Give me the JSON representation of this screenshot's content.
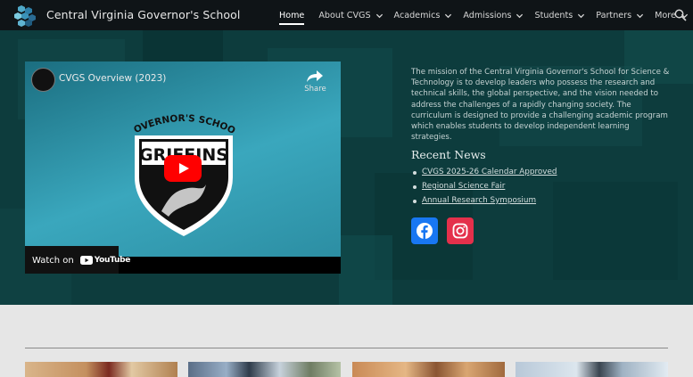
{
  "header": {
    "site_title": "Central Virginia Governor's School",
    "nav": [
      {
        "label": "Home",
        "has_dropdown": false,
        "active": true
      },
      {
        "label": "About CVGS",
        "has_dropdown": true
      },
      {
        "label": "Academics",
        "has_dropdown": true
      },
      {
        "label": "Admissions",
        "has_dropdown": true
      },
      {
        "label": "Students",
        "has_dropdown": true
      },
      {
        "label": "Partners",
        "has_dropdown": true
      },
      {
        "label": "More",
        "has_dropdown": true
      }
    ],
    "search_icon": "search-icon"
  },
  "video": {
    "title": "CVGS Overview (2023)",
    "share_label": "Share",
    "watch_on": "Watch on",
    "platform": "YouTube",
    "logo_top_text": "GOVERNOR'S SCHOOL",
    "logo_main_text": "GRIFFINS"
  },
  "mission": {
    "text": "The mission of the Central Virginia Governor's School for Science & Technology is to develop leaders who possess the research and technical skills, the global perspective, and the vision needed to address the challenges of a rapidly changing society. The curriculum is designed to provide a challenging academic program which enables students to develop independent learning strategies."
  },
  "news": {
    "title": "Recent News",
    "items": [
      "CVGS 2025-26 Calendar Approved",
      "Regional Science Fair",
      "Annual Research Symposium"
    ]
  },
  "social": {
    "facebook": "facebook-icon",
    "instagram": "instagram-icon"
  },
  "colors": {
    "topbar": "#0f1417",
    "hero_bg": "#0d3c3d",
    "youtube_red": "#ff0000",
    "facebook_blue": "#1877f2",
    "instagram_red": "#e4304b"
  }
}
